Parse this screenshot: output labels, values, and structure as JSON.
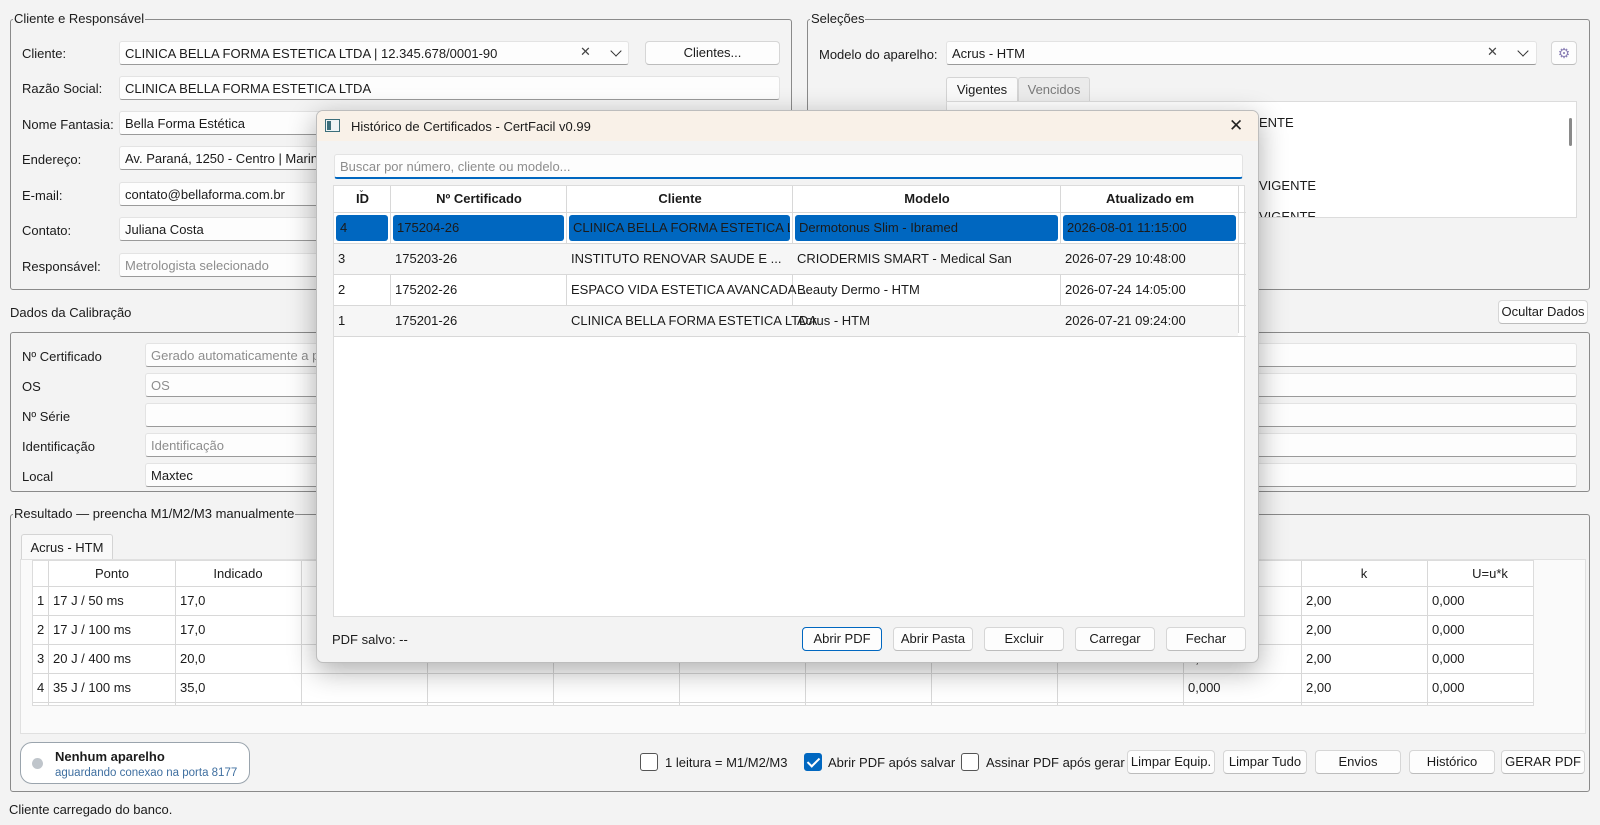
{
  "cliente_group": {
    "legend": "Cliente e Responsável",
    "cliente_label": "Cliente:",
    "cliente_value": "CLINICA BELLA FORMA ESTETICA LTDA | 12.345.678/0001-90",
    "clientes_button": "Clientes...",
    "razao_label": "Razão Social:",
    "razao_value": "CLINICA BELLA FORMA ESTETICA LTDA",
    "fantasia_label": "Nome Fantasia:",
    "fantasia_value": "Bella Forma Estética",
    "endereco_label": "Endereço:",
    "endereco_value": "Av. Paraná, 1250 - Centro | Maringá/",
    "email_label": "E-mail:",
    "email_value": "contato@bellaforma.com.br",
    "contato_label": "Contato:",
    "contato_value": "Juliana Costa",
    "responsavel_label": "Responsável:",
    "responsavel_placeholder": "Metrologista selecionado"
  },
  "selecoes_group": {
    "legend": "Seleções",
    "modelo_label": "Modelo do aparelho:",
    "modelo_value": "Acrus - HTM",
    "tabs": [
      "Vigentes",
      "Vencidos"
    ],
    "list_fragments": [
      "ENTE",
      "VIGENTE",
      "VIGENTE"
    ]
  },
  "calibracao": {
    "title": "Dados da Calibração",
    "ocultar_button": "Ocultar Dados",
    "certificado_label": "Nº Certificado",
    "certificado_placeholder": "Gerado automaticamente a par",
    "os_label": "OS",
    "os_placeholder": "OS",
    "serie_label": "Nº Série",
    "identificacao_label": "Identificação",
    "identificacao_placeholder": "Identificação",
    "local_label": "Local",
    "local_value": "Maxtec"
  },
  "resultado": {
    "legend": "Resultado — preencha M1/M2/M3 manualmente",
    "tab": "Acrus - HTM",
    "headers": {
      "ponto": "Ponto",
      "indicado": "Indicado",
      "k": "k",
      "u": "U=u*k"
    },
    "rows": [
      {
        "n": "1",
        "ponto": "17 J / 50 ms",
        "indicado": "17,0",
        "inc": "",
        "k": "2,00",
        "u": "0,000"
      },
      {
        "n": "2",
        "ponto": "17 J / 100 ms",
        "indicado": "17,0",
        "inc": "",
        "k": "2,00",
        "u": "0,000"
      },
      {
        "n": "3",
        "ponto": "20 J / 400 ms",
        "indicado": "20,0",
        "inc": "0,000",
        "k": "2,00",
        "u": "0,000"
      },
      {
        "n": "4",
        "ponto": "35 J / 100 ms",
        "indicado": "35,0",
        "inc": "0,000",
        "k": "2,00",
        "u": "0,000"
      }
    ]
  },
  "bottom": {
    "device_title": "Nenhum aparelho",
    "device_sub": "aguardando conexao na porta 8177",
    "chk_leitura": "1 leitura = M1/M2/M3",
    "chk_abrir": "Abrir PDF após salvar",
    "chk_assinar": "Assinar PDF após gerar",
    "buttons": [
      "Limpar Equip.",
      "Limpar Tudo",
      "Envios",
      "Histórico",
      "GERAR PDF"
    ],
    "status": "Cliente carregado do banco."
  },
  "dialog": {
    "title": "Histórico de Certificados - CertFacil v0.99",
    "search_placeholder": "Buscar por número, cliente ou modelo...",
    "columns": [
      "ID",
      "Nº Certificado",
      "Cliente",
      "Modelo",
      "Atualizado em"
    ],
    "rows": [
      {
        "id": "4",
        "cert": "175204-26",
        "cliente": "CLINICA BELLA FORMA ESTETICA LTDA",
        "modelo": "Dermotonus Slim - Ibramed",
        "data": "2026-08-01 11:15:00",
        "selected": true
      },
      {
        "id": "3",
        "cert": "175203-26",
        "cliente": "INSTITUTO RENOVAR SAUDE E ...",
        "modelo": "CRIODERMIS SMART - Medical San",
        "data": "2026-07-29 10:48:00",
        "selected": false
      },
      {
        "id": "2",
        "cert": "175202-26",
        "cliente": "ESPACO VIDA ESTETICA AVANCADA ...",
        "modelo": "Beauty Dermo - HTM",
        "data": "2026-07-24 14:05:00",
        "selected": false
      },
      {
        "id": "1",
        "cert": "175201-26",
        "cliente": "CLINICA BELLA FORMA ESTETICA LTDA",
        "modelo": "Acrus - HTM",
        "data": "2026-07-21 09:24:00",
        "selected": false
      }
    ],
    "pdf_status": "PDF salvo: --",
    "buttons": [
      "Abrir PDF",
      "Abrir Pasta",
      "Excluir",
      "Carregar",
      "Fechar"
    ]
  },
  "colors": {
    "accent": "#0067c0",
    "titlebar": "#f9f1e8"
  }
}
